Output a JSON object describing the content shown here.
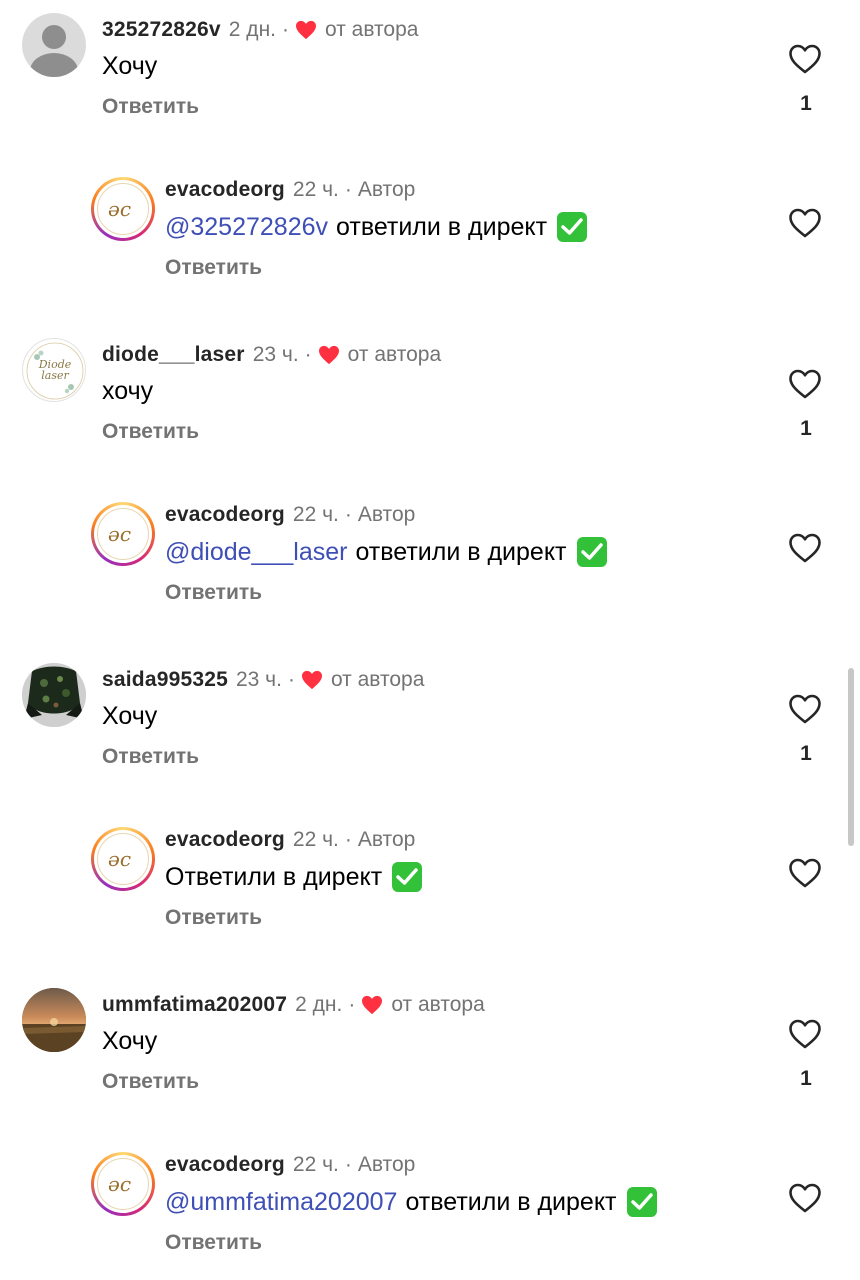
{
  "reply_label": "Ответить",
  "from_author_label": "от автора",
  "author_label": "Автор",
  "threads": [
    {
      "comment": {
        "username": "325272826v",
        "time": "2 дн.",
        "text": "Хочу",
        "likes": "1",
        "avatar": "default-person-avatar"
      },
      "reply": {
        "username": "evacodeorg",
        "time": "22 ч.",
        "mention": "@325272826v",
        "text": "ответили в директ"
      }
    },
    {
      "comment": {
        "username": "diode___laser",
        "time": "23 ч.",
        "text": "хочу",
        "likes": "1",
        "avatar": "diode-laser-logo-avatar",
        "avatar_text_1": "Diode",
        "avatar_text_2": "laser"
      },
      "reply": {
        "username": "evacodeorg",
        "time": "22 ч.",
        "mention": "@diode___laser",
        "text": "ответили в директ"
      }
    },
    {
      "comment": {
        "username": "saida995325",
        "time": "23 ч.",
        "text": "Хочу",
        "likes": "1",
        "avatar": "dark-floral-photo-avatar"
      },
      "reply": {
        "username": "evacodeorg",
        "time": "22 ч.",
        "mention": "",
        "text": "Ответили в директ"
      }
    },
    {
      "comment": {
        "username": "ummfatima202007",
        "time": "2 дн.",
        "text": "Хочу",
        "likes": "1",
        "avatar": "sunset-field-photo-avatar"
      },
      "reply": {
        "username": "evacodeorg",
        "time": "22 ч.",
        "mention": "@ummfatima202007",
        "text": "ответили в директ"
      }
    }
  ],
  "colors": {
    "heart": "#ff3040",
    "mention": "#3e4fb6",
    "secondary_text": "#737373",
    "check": "#33c13a"
  }
}
